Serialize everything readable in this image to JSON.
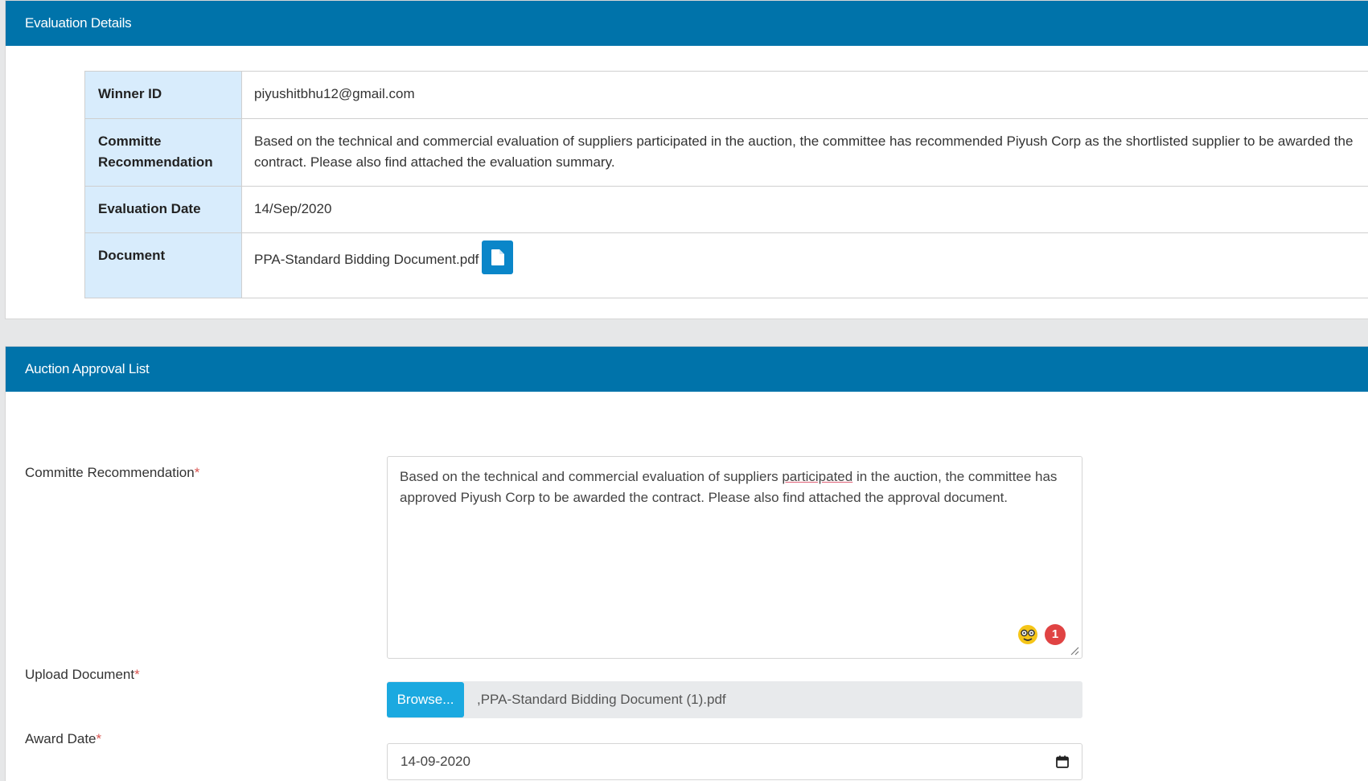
{
  "evaluation": {
    "header": "Evaluation Details",
    "rows": [
      {
        "label": "Winner ID",
        "value": "piyushitbhu12@gmail.com"
      },
      {
        "label": "Committe Recommendation",
        "value": "Based on the technical and commercial evaluation of suppliers participated in the auction, the committee has recommended Piyush Corp as the shortlisted supplier to be awarded the contract. Please also find attached the evaluation summary."
      },
      {
        "label": "Evaluation Date",
        "value": "14/Sep/2020"
      },
      {
        "label": "Document",
        "value": "PPA-Standard Bidding Document.pdf"
      }
    ]
  },
  "approval": {
    "header": "Auction Approval List",
    "recommendation_label": "Committe Recommendation",
    "recommendation_text_before": "Based on the technical and commercial evaluation of suppliers ",
    "recommendation_text_flagged": "participated",
    "recommendation_text_after": " in the auction, the committee has approved Piyush Corp to be awarded the contract. Please also find attached the approval document.",
    "grammar_badge_count": "1",
    "upload_label": "Upload Document",
    "browse_label": "Browse...",
    "upload_file": ",PPA-Standard Bidding Document (1).pdf",
    "award_label": "Award Date",
    "award_value": "14-09-2020",
    "required_mark": "*"
  },
  "colors": {
    "header_bg": "#0073aa",
    "label_bg": "#d8ecfc",
    "browse_bg": "#1ba9e0",
    "required": "#d9534f"
  },
  "icons": [
    "file-icon",
    "grammar-assistant-icon",
    "calendar-icon",
    "resize-handle-icon"
  ]
}
